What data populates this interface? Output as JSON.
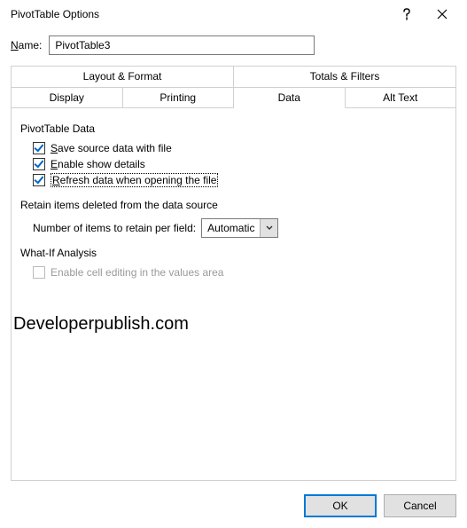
{
  "title": "PivotTable Options",
  "name_label_pre": "N",
  "name_label_rest": "ame:",
  "name_value": "PivotTable3",
  "tabs_row1": [
    {
      "label": "Layout & Format"
    },
    {
      "label": "Totals & Filters"
    }
  ],
  "tabs_row2": [
    {
      "label": "Display"
    },
    {
      "label": "Printing"
    },
    {
      "label": "Data"
    },
    {
      "label": "Alt Text"
    }
  ],
  "sections": {
    "pivot_data": {
      "title": "PivotTable Data",
      "save_ul": "S",
      "save_rest": "ave source data with file",
      "enable_ul": "E",
      "enable_rest": "nable show details",
      "refresh_ul": "R",
      "refresh_rest": "efresh data when opening the file"
    },
    "retain": {
      "title": "Retain items deleted from the data source",
      "num_ul": "N",
      "num_rest": "umber of items to retain per field:",
      "num_value": "Automatic"
    },
    "whatif": {
      "title": "What-If Analysis",
      "enable_cell": "Enable cell editing in the values area"
    }
  },
  "watermark": "Developerpublish.com",
  "buttons": {
    "ok": "OK",
    "cancel": "Cancel"
  }
}
